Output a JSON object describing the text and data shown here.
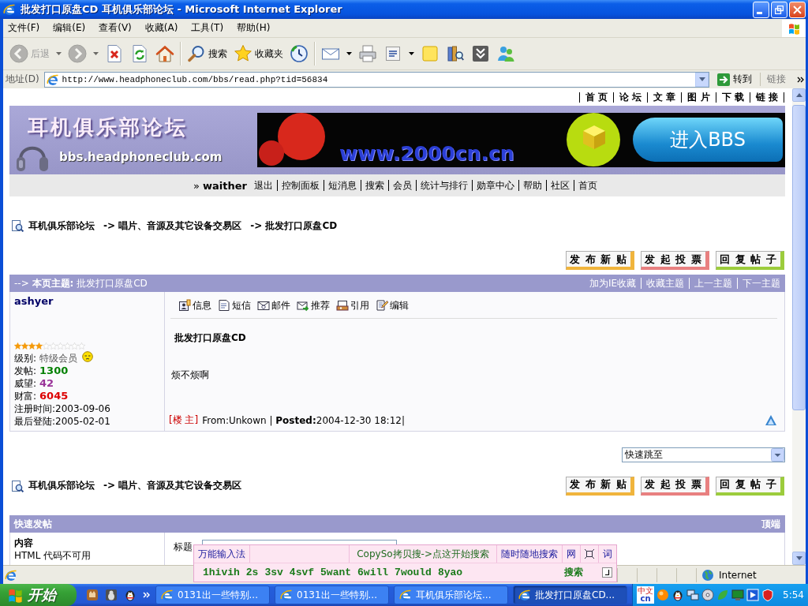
{
  "window": {
    "title": "批发打口原盘CD 耳机俱乐部论坛 - Microsoft Internet Explorer"
  },
  "menu_bar": [
    {
      "label": "文件(F)"
    },
    {
      "label": "编辑(E)"
    },
    {
      "label": "查看(V)"
    },
    {
      "label": "收藏(A)"
    },
    {
      "label": "工具(T)"
    },
    {
      "label": "帮助(H)"
    }
  ],
  "toolbar": [
    {
      "items": [
        {
          "kind": "back",
          "label": "后退",
          "dropdown": true,
          "disabled": true
        },
        {
          "kind": "forward",
          "dropdown": true,
          "disabled": true
        },
        {
          "kind": "stop",
          "dropdown": false,
          "disabled": false
        },
        {
          "kind": "refresh",
          "dropdown": false,
          "disabled": false
        },
        {
          "kind": "home",
          "dropdown": false,
          "disabled": false
        }
      ]
    },
    {
      "items": [
        {
          "kind": "search",
          "label": "搜索",
          "dropdown": false,
          "disabled": false
        },
        {
          "kind": "favorites",
          "label": "收藏夹",
          "dropdown": false,
          "disabled": false
        },
        {
          "kind": "history",
          "dropdown": false,
          "disabled": false
        }
      ]
    },
    {
      "items": [
        {
          "kind": "mail",
          "dropdown": true,
          "disabled": false
        },
        {
          "kind": "print",
          "dropdown": false,
          "disabled": false
        },
        {
          "kind": "edit",
          "dropdown": true,
          "disabled": false
        },
        {
          "kind": "note",
          "dropdown": false,
          "disabled": false
        },
        {
          "kind": "research",
          "dropdown": false,
          "disabled": false
        },
        {
          "kind": "extra",
          "dropdown": false,
          "disabled": false
        },
        {
          "kind": "messenger",
          "dropdown": false,
          "disabled": false
        }
      ]
    }
  ],
  "address_bar": {
    "label": "地址(D)",
    "value": "http://www.headphoneclub.com/bbs/read.php?tid=56834",
    "go_label": "转到",
    "links_label": "链接"
  },
  "page": {
    "top_links": [
      "首 页",
      "论 坛",
      "文 章",
      "图 片",
      "下 载",
      "链 接"
    ],
    "banner": {
      "logo_title": "耳机俱乐部论坛",
      "logo_url": "bbs.headphoneclub.com",
      "ad_url": "www.2000cn.cn",
      "ad_button": "进入BBS"
    },
    "user_nav": {
      "prefix": "»",
      "user": "waither",
      "links": [
        "退出",
        "控制面板",
        "短消息",
        "搜索",
        "会员",
        "统计与排行",
        "勋章中心",
        "帮助",
        "社区",
        "首页"
      ]
    },
    "breadcrumb": [
      "耳机俱乐部论坛",
      "-> 唱片、音源及其它设备交易区",
      "-> 批发打口原盘CD"
    ],
    "action_buttons": [
      {
        "label": "发 布 新 贴",
        "color": "#f0b43c"
      },
      {
        "label": "发 起 投 票",
        "color": "#e88080"
      },
      {
        "label": "回 复 帖 子",
        "color": "#9ccc3c"
      }
    ],
    "topic_bar": {
      "heading": "--> **本页主题:** 批发打口原盘CD",
      "links": [
        "加为IE收藏",
        "收藏主题",
        "上一主题",
        "下一主题"
      ]
    },
    "post": {
      "author": "ashyer",
      "stars": 4,
      "rank_label": "级别:",
      "rank": "特级会员",
      "stats": [
        {
          "label": "发帖:",
          "value": "1300",
          "color": "#008000"
        },
        {
          "label": "威望:",
          "value": "42",
          "color": "#993399"
        },
        {
          "label": "财富:",
          "value": "6045",
          "color": "#dd0000"
        }
      ],
      "registered": "注册时间:2003-09-06",
      "last_login": "最后登陆:2005-02-01",
      "actions": [
        {
          "kind": "info",
          "label": "信息"
        },
        {
          "kind": "message",
          "label": "短信"
        },
        {
          "kind": "mail",
          "label": "邮件"
        },
        {
          "kind": "recommend",
          "label": "推荐"
        },
        {
          "kind": "quote",
          "label": "引用"
        },
        {
          "kind": "edit",
          "label": "编辑"
        }
      ],
      "title": "批发打口原盘CD",
      "body": "烦不烦啊",
      "floor": "[楼 主]",
      "meta": "From:Unkown | **Posted:**2004-12-30 18:12|"
    },
    "quick_jump": {
      "value": "快速跳至"
    },
    "footer_breadcrumb": [
      "耳机俱乐部论坛",
      "-> 唱片、音源及其它设备交易区"
    ],
    "footer_buttons": [
      {
        "label": "发 布 新 贴",
        "color": "#f0b43c"
      },
      {
        "label": "发 起 投 票",
        "color": "#e88080"
      },
      {
        "label": "回 复 帖 子",
        "color": "#9ccc3c"
      }
    ],
    "quick_post": {
      "title": "快速发帖",
      "top_link": "顶端",
      "content_label": "内容",
      "html_note": "HTML 代码不可用",
      "subject_label": "标题"
    }
  },
  "ime": {
    "title": "万能输入法",
    "search_prompt": "CopySo拷贝搜->点这开始搜索",
    "search_anywhere": "随时随地搜索",
    "web": "网",
    "word": "词",
    "candidates": [
      "1hivih",
      "2s",
      "3sv",
      "4svf",
      "5want",
      "6will",
      "7would",
      "8yao"
    ],
    "search": "搜索"
  },
  "status_bar": {
    "zone": "Internet"
  },
  "taskbar": {
    "start": "开始",
    "tasks": [
      {
        "label": "0131出一些特别...",
        "selected": false
      },
      {
        "label": "0131出一些特别...",
        "selected": false
      },
      {
        "label": "耳机俱乐部论坛...",
        "selected": false
      },
      {
        "label": "批发打口原盘CD...",
        "selected": true
      }
    ],
    "ime_indicator": {
      "language": "中文",
      "code": "cn"
    },
    "clock": "5:54"
  }
}
